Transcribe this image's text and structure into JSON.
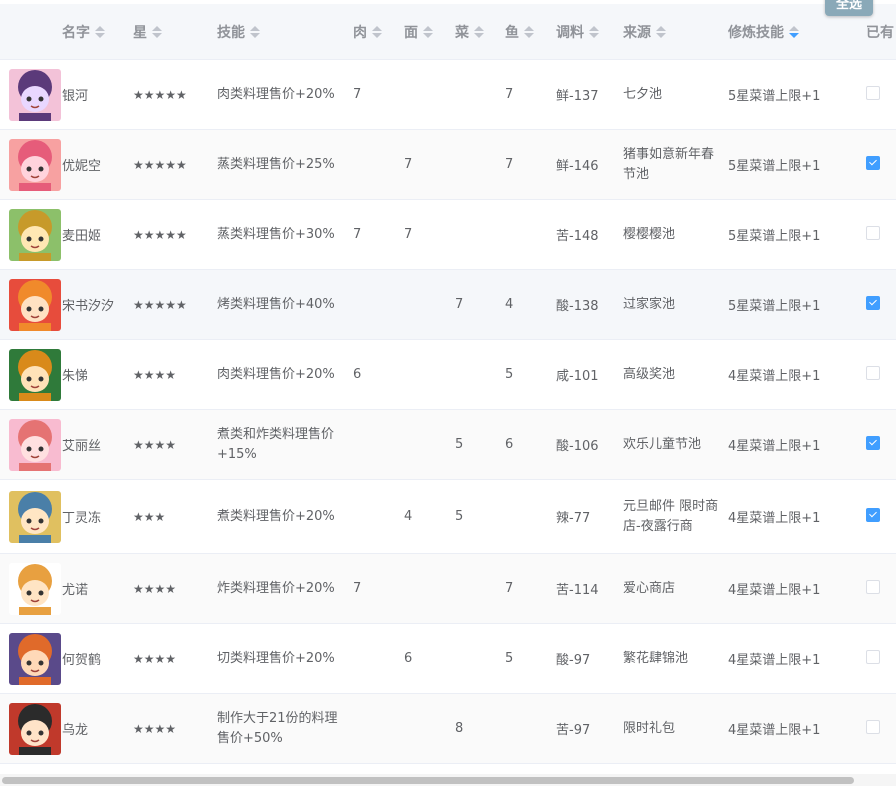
{
  "toolbar": {
    "select_all_label": "全选"
  },
  "headers": {
    "name": "名字",
    "star": "星",
    "skill": "技能",
    "meat": "肉",
    "noodle": "面",
    "veg": "菜",
    "fish": "鱼",
    "seasoning": "调料",
    "source": "来源",
    "training": "修炼技能",
    "owned": "已有"
  },
  "rows": [
    {
      "name": "银河",
      "star": "★★★★★",
      "skill": "肉类料理售价+20%",
      "meat": "7",
      "noodle": "",
      "veg": "",
      "fish": "7",
      "seasoning": "鲜-137",
      "source": "七夕池",
      "training": "5星菜谱上限+1",
      "owned": false,
      "avatar_colors": [
        "#5b3a7a",
        "#e9d7ff",
        "#f3c2d8"
      ]
    },
    {
      "name": "优妮空",
      "star": "★★★★★",
      "skill": "蒸类料理售价+25%",
      "meat": "",
      "noodle": "7",
      "veg": "",
      "fish": "7",
      "seasoning": "鲜-146",
      "source": "猪事如意新年春节池",
      "training": "5星菜谱上限+1",
      "owned": true,
      "avatar_colors": [
        "#e65c7a",
        "#ffd3dc",
        "#f7a1a1"
      ]
    },
    {
      "name": "麦田姬",
      "star": "★★★★★",
      "skill": "蒸类料理售价+30%",
      "meat": "7",
      "noodle": "7",
      "veg": "",
      "fish": "",
      "seasoning": "苦-148",
      "source": "樱樱樱池",
      "training": "5星菜谱上限+1",
      "owned": false,
      "avatar_colors": [
        "#c79a2a",
        "#ffe7b3",
        "#8cc06a"
      ]
    },
    {
      "name": "宋书汐汐",
      "star": "★★★★★",
      "skill": "烤类料理售价+40%",
      "meat": "",
      "noodle": "",
      "veg": "7",
      "fish": "4",
      "seasoning": "酸-138",
      "source": "过家家池",
      "training": "5星菜谱上限+1",
      "owned": true,
      "avatar_colors": [
        "#f08a2b",
        "#ffe1c2",
        "#e74c3c"
      ]
    },
    {
      "name": "朱悌",
      "star": "★★★★",
      "skill": "肉类料理售价+20%",
      "meat": "6",
      "noodle": "",
      "veg": "",
      "fish": "5",
      "seasoning": "咸-101",
      "source": "高级奖池",
      "training": "4星菜谱上限+1",
      "owned": false,
      "avatar_colors": [
        "#d98a1a",
        "#ffe2b8",
        "#2f7a3a"
      ]
    },
    {
      "name": "艾丽丝",
      "star": "★★★★",
      "skill": "煮类和炸类料理售价+15%",
      "meat": "",
      "noodle": "",
      "veg": "5",
      "fish": "6",
      "seasoning": "酸-106",
      "source": "欢乐儿童节池",
      "training": "4星菜谱上限+1",
      "owned": true,
      "avatar_colors": [
        "#e57373",
        "#ffe0e0",
        "#f8bbd0"
      ]
    },
    {
      "name": "丁灵冻",
      "star": "★★★",
      "skill": "煮类料理售价+20%",
      "meat": "",
      "noodle": "4",
      "veg": "5",
      "fish": "",
      "seasoning": "辣-77",
      "source": "元旦邮件 限时商店-夜露行商",
      "training": "4星菜谱上限+1",
      "owned": true,
      "avatar_colors": [
        "#4a7fa8",
        "#ffe6c4",
        "#e0c060"
      ]
    },
    {
      "name": "尤诺",
      "star": "★★★★",
      "skill": "炸类料理售价+20%",
      "meat": "7",
      "noodle": "",
      "veg": "",
      "fish": "7",
      "seasoning": "苦-114",
      "source": "爱心商店",
      "training": "4星菜谱上限+1",
      "owned": false,
      "avatar_colors": [
        "#e8a040",
        "#ffe4c4",
        "#ffffff"
      ]
    },
    {
      "name": "何贺鹤",
      "star": "★★★★",
      "skill": "切类料理售价+20%",
      "meat": "",
      "noodle": "6",
      "veg": "",
      "fish": "5",
      "seasoning": "酸-97",
      "source": "繁花肆锦池",
      "training": "4星菜谱上限+1",
      "owned": false,
      "avatar_colors": [
        "#e06a2a",
        "#ffd9b8",
        "#5a4a8a"
      ]
    },
    {
      "name": "乌龙",
      "star": "★★★★",
      "skill": "制作大于21份的料理售价+50%",
      "meat": "",
      "noodle": "",
      "veg": "8",
      "fish": "",
      "seasoning": "苦-97",
      "source": "限时礼包",
      "training": "4星菜谱上限+1",
      "owned": false,
      "avatar_colors": [
        "#2b2b2b",
        "#ffe3c8",
        "#c0392b"
      ]
    }
  ]
}
